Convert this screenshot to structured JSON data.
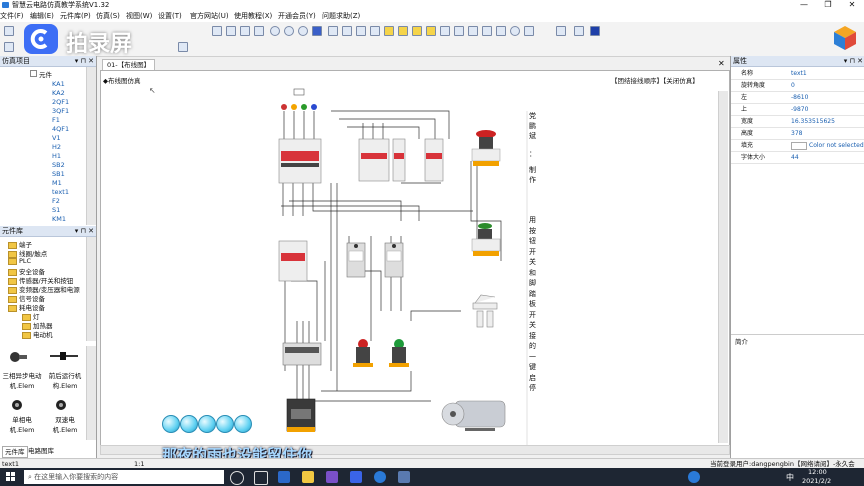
{
  "window": {
    "title": "智慧云电路仿真教学系统V1.32",
    "min": "—",
    "max": "❐",
    "close": "✕"
  },
  "menu": [
    "文件(F)",
    "编辑(E)",
    "元件库(P)",
    "仿真(S)",
    "视图(W)",
    "设置(T)",
    "官方网站(U)",
    "使用教程(X)",
    "开通会员(Y)",
    "问题求助(Z)"
  ],
  "overlay_logo": "拍录屏",
  "left": {
    "sim_items_title": "仿真项目",
    "pin": "▾ ⊓ ✕",
    "tree_root": "元件",
    "components": [
      "KA1",
      "KA2",
      "2QF1",
      "3QF1",
      "F1",
      "4QF1",
      "V1",
      "H2",
      "H1",
      "SB2",
      "SB1",
      "M1",
      "text1",
      "F2",
      "S1",
      "KM1"
    ],
    "library_title": "元件库",
    "library": [
      "端子",
      "线圈/触点",
      "PLC",
      "安全设备",
      "传感器/开关和按钮",
      "变频器/变压器和电源",
      "信号设备",
      "耗电设备",
      "灯",
      "加热器",
      "电动机"
    ],
    "thumbs": [
      {
        "label": "三相异步电动机.Elem"
      },
      {
        "label": "前后运行机构.Elem"
      },
      {
        "label": "单相电机.Elem"
      },
      {
        "label": "双速电机.Elem"
      }
    ],
    "bottom_tabs": [
      "元件库",
      "电路图库"
    ]
  },
  "doc": {
    "tab": "01-【布线图】",
    "close": "✕",
    "header_left": "◆布线图仿真",
    "header_right": "【团结接线顺序】【关闭仿真】",
    "vertical_text_1": [
      "党",
      "鹏",
      "斌",
      "：",
      "",
      "制",
      "作"
    ],
    "vertical_text_2": [
      "用",
      "按",
      "钮",
      "开",
      "关",
      "和",
      "脚",
      "踏",
      "板",
      "开",
      "关",
      "接",
      "的",
      "一",
      "键",
      "启",
      "停"
    ]
  },
  "properties": {
    "title": "属性",
    "rows": [
      {
        "k": "名称",
        "v": "text1"
      },
      {
        "k": "旋转角度",
        "v": "0"
      },
      {
        "k": "左",
        "v": "-8610"
      },
      {
        "k": "上",
        "v": "-9870"
      },
      {
        "k": "宽度",
        "v": "16.353515625"
      },
      {
        "k": "高度",
        "v": "378"
      },
      {
        "k": "填充",
        "v": "Color not selected"
      },
      {
        "k": "字体大小",
        "v": "44"
      }
    ],
    "summary_title": "简介"
  },
  "status": {
    "left": "text1",
    "mid": "1:1",
    "right": "当前登录用户:dangpengbin【网络请阅】-永久会"
  },
  "taskbar": {
    "search_placeholder": "在这里输入你要搜索的内容",
    "time": "12:00",
    "date": "2021/2/2",
    "ime": "中"
  },
  "subtitle": "那夜的雨也没能留住你"
}
